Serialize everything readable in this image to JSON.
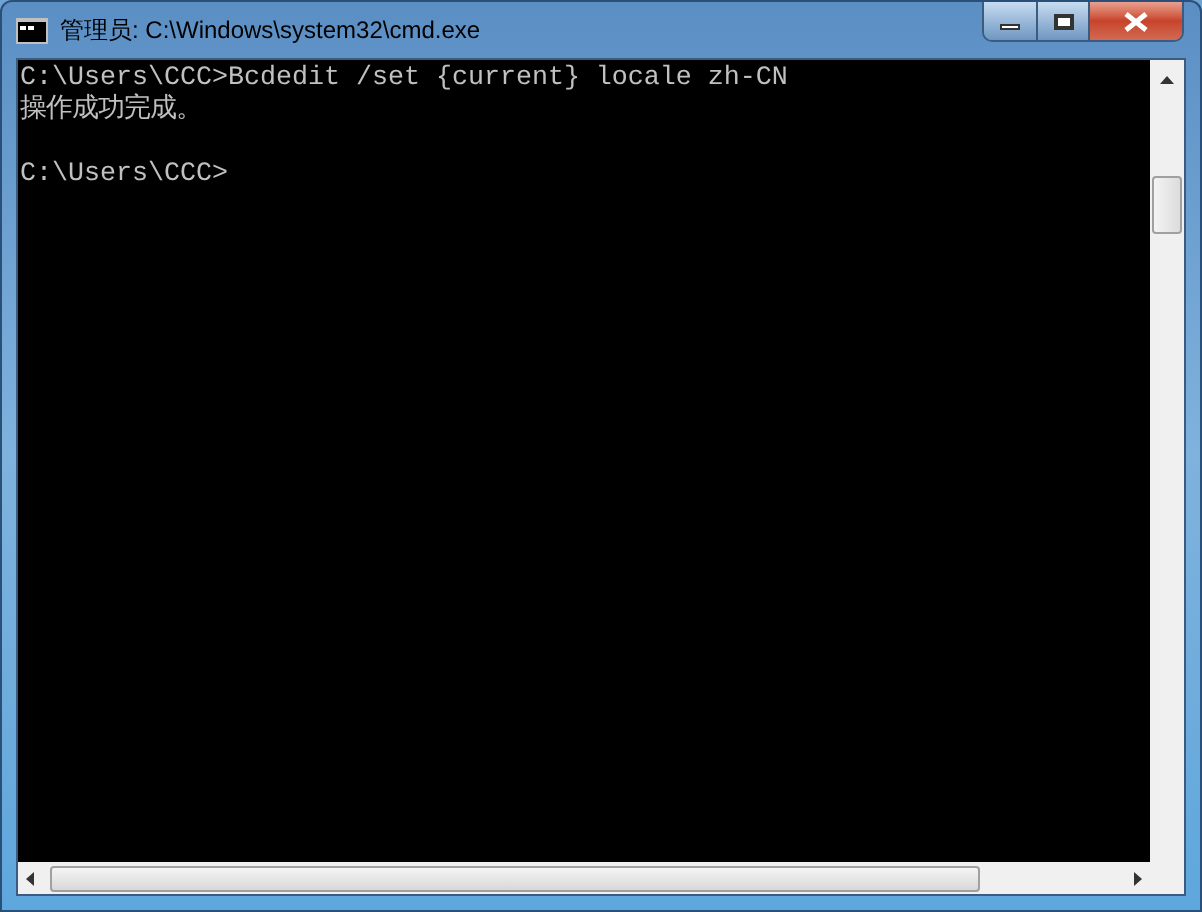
{
  "window": {
    "title": "管理员: C:\\Windows\\system32\\cmd.exe"
  },
  "console": {
    "blocks": [
      {
        "lines": [
          "C:\\Users\\CCC>Bcdedit /set {current} locale zh-CN",
          "操作成功完成。"
        ]
      },
      {
        "lines": [
          "C:\\Users\\CCC>"
        ]
      }
    ]
  }
}
